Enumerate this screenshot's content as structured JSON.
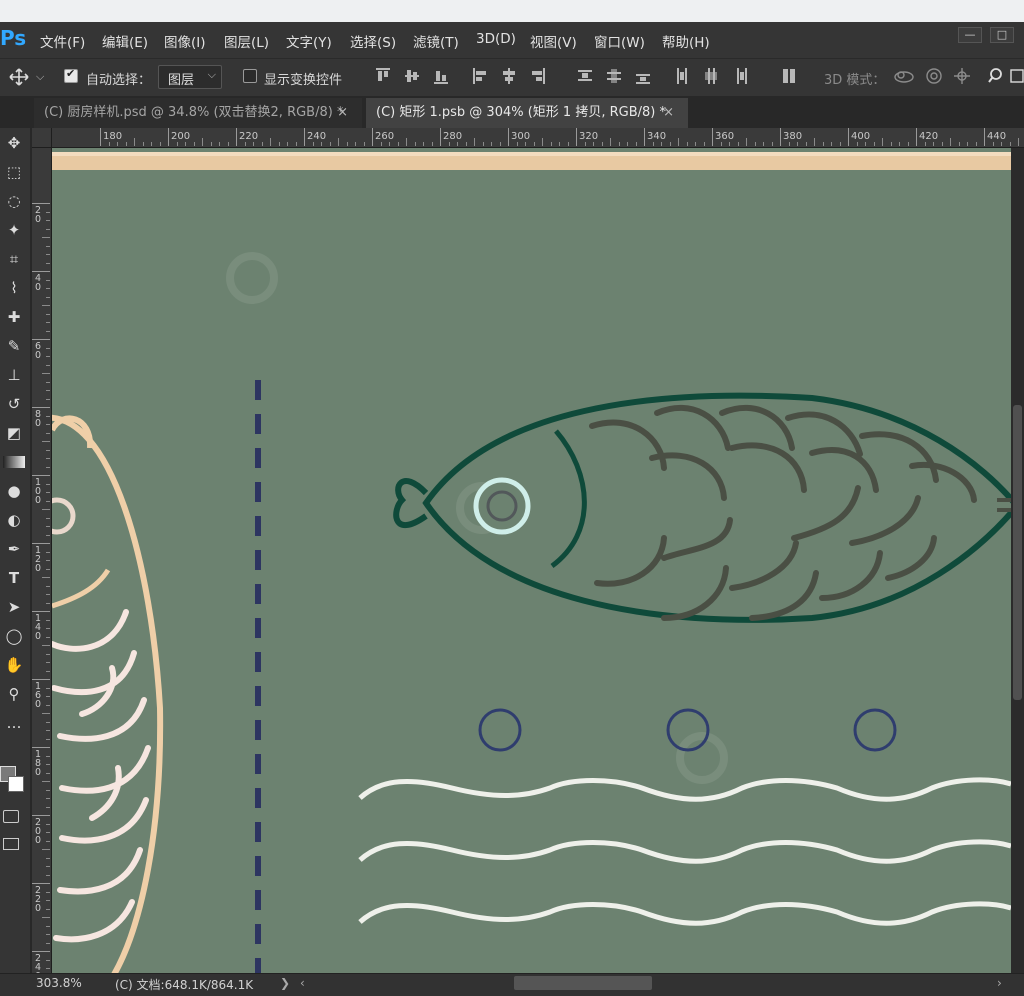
{
  "app": {
    "logo": "Ps"
  },
  "menu": [
    "文件(F)",
    "编辑(E)",
    "图像(I)",
    "图层(L)",
    "文字(Y)",
    "选择(S)",
    "滤镜(T)",
    "3D(D)",
    "视图(V)",
    "窗口(W)",
    "帮助(H)"
  ],
  "window_controls": {
    "minimize": "—",
    "restore": "□"
  },
  "options_bar": {
    "auto_select_label": "自动选择：",
    "auto_select_checked": true,
    "auto_select_target": "图层",
    "show_transform_label": "显示变换控件",
    "show_transform_checked": false,
    "mode_3d_label": "3D 模式："
  },
  "tabs": [
    {
      "label": "(C) 厨房样机.psd @ 34.8% (双击替换2, RGB/8) *",
      "active": false,
      "close": "×"
    },
    {
      "label": "(C) 矩形 1.psb @ 304% (矩形 1 拷贝, RGB/8) *",
      "active": true,
      "close": "×"
    }
  ],
  "ruler": {
    "horizontal": [
      "180",
      "200",
      "220",
      "240",
      "260",
      "280",
      "300",
      "320",
      "340",
      "360",
      "380",
      "400",
      "420",
      "440"
    ],
    "vertical": [
      "2 0",
      "4 0",
      "6 0",
      "8 0",
      "1 0 0",
      "1 2 0",
      "1 4 0",
      "1 6 0",
      "1 8 0",
      "2 0 0",
      "2 2 0",
      "2 4 0"
    ]
  },
  "tools": [
    "move-tool",
    "marquee-tool",
    "lasso-tool",
    "magic-wand-tool",
    "crop-tool",
    "eyedropper-tool",
    "healing-tool",
    "brush-tool",
    "stamp-tool",
    "history-brush-tool",
    "eraser-tool",
    "gradient-tool",
    "blur-tool",
    "dodge-tool",
    "pen-tool",
    "type-tool",
    "path-select-tool",
    "ellipse-tool",
    "hand-tool",
    "zoom-tool",
    "more-tools"
  ],
  "tool_glyphs": {
    "type-tool": "T"
  },
  "status": {
    "zoom": "303.8%",
    "doc_info": "(C) 文档:648.1K/864.1K",
    "arrow": "❯"
  },
  "colors": {
    "canvas": "#6c8270",
    "fish_outline": "#0f4a3a",
    "scales_dark": "#4a4f44",
    "cream": "#efcfa8",
    "scales_light": "#f6e6e0",
    "dash": "#2d3561",
    "bubble": "#2f3d6e",
    "wave": "#eef0ea"
  }
}
